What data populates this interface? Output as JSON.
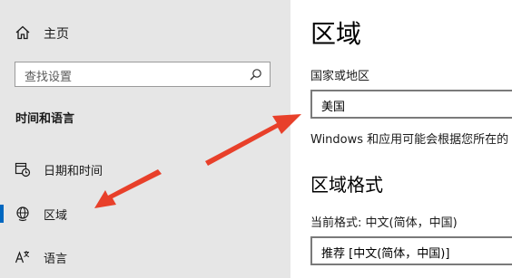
{
  "sidebar": {
    "home_label": "主页",
    "search_placeholder": "查找设置",
    "section_title": "时间和语言",
    "items": [
      {
        "label": "日期和时间",
        "icon": "calendar-clock-icon",
        "selected": false
      },
      {
        "label": "区域",
        "icon": "globe-icon",
        "selected": true
      },
      {
        "label": "语言",
        "icon": "language-icon",
        "selected": false
      }
    ]
  },
  "main": {
    "title": "区域",
    "country_label": "国家或地区",
    "country_value": "美国",
    "country_desc": "Windows 和应用可能会根据您所在的",
    "format_heading": "区域格式",
    "current_format_label": "当前格式: 中文(简体，中国)",
    "format_value": "推荐 [中文(简体，中国)]"
  },
  "colors": {
    "sidebar_bg": "#e6e6e6",
    "accent": "#0067c0",
    "annotation_arrow": "#e8402a"
  }
}
